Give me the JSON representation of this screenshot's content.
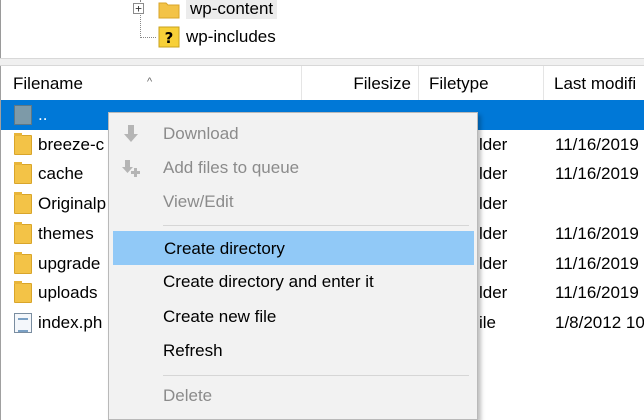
{
  "tree": {
    "items": [
      {
        "label": "wp-content",
        "icon": "folder-icon",
        "expander": "+"
      },
      {
        "label": "wp-includes",
        "icon": "unknown-folder-icon"
      }
    ]
  },
  "list": {
    "headers": {
      "filename": "Filename",
      "filesize": "Filesize",
      "filetype": "Filetype",
      "lastmodified": "Last modifi"
    },
    "sort_indicator": "^",
    "rows": [
      {
        "name": "..",
        "size": "",
        "type": "",
        "modified": "",
        "icon": "parent-dir-icon"
      },
      {
        "name": "breeze-c",
        "size": "",
        "type": "lder",
        "modified": "11/16/2019",
        "icon": "folder-icon"
      },
      {
        "name": "cache",
        "size": "",
        "type": "lder",
        "modified": "11/16/2019",
        "icon": "folder-icon"
      },
      {
        "name": "Originalp",
        "size": "",
        "type": "lder",
        "modified": "",
        "icon": "folder-icon"
      },
      {
        "name": "themes",
        "size": "",
        "type": "lder",
        "modified": "11/16/2019",
        "icon": "folder-icon"
      },
      {
        "name": "upgrade",
        "size": "",
        "type": "lder",
        "modified": "11/16/2019",
        "icon": "folder-icon"
      },
      {
        "name": "uploads",
        "size": "",
        "type": "lder",
        "modified": "11/16/2019",
        "icon": "folder-icon"
      },
      {
        "name": "index.ph",
        "size": "",
        "type": "ile",
        "modified": "1/8/2012 10",
        "icon": "php-file-icon"
      }
    ]
  },
  "context_menu": {
    "items": [
      {
        "label": "Download",
        "enabled": false,
        "icon": "download-icon"
      },
      {
        "label": "Add files to queue",
        "enabled": false,
        "icon": "add-to-queue-icon"
      },
      {
        "label": "View/Edit",
        "enabled": false
      },
      {
        "label": "Create directory",
        "enabled": true,
        "highlighted": true
      },
      {
        "label": "Create directory and enter it",
        "enabled": true
      },
      {
        "label": "Create new file",
        "enabled": true
      },
      {
        "label": "Refresh",
        "enabled": true
      },
      {
        "label": "Delete",
        "enabled": false
      }
    ]
  },
  "colors": {
    "selection": "#0078d7",
    "menu_highlight": "#91c9f7",
    "menu_background": "#f2f2f2",
    "disabled_text": "#8b8b8b",
    "folder": "#f3c347"
  }
}
